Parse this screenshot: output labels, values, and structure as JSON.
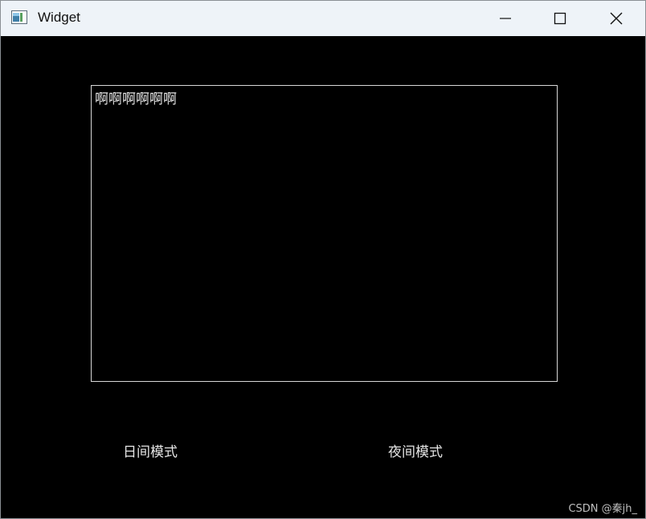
{
  "window": {
    "title": "Widget",
    "controls": {
      "minimize": "minimize-icon",
      "maximize": "maximize-icon",
      "close": "close-icon"
    }
  },
  "editor": {
    "text": "啊啊啊啊啊啊"
  },
  "buttons": {
    "day_mode": "日间模式",
    "night_mode": "夜间模式"
  },
  "watermark": "CSDN @秦jh_",
  "colors": {
    "titlebar": "#eef3f8",
    "client_background": "#000000",
    "text": "#e6e6e6"
  }
}
